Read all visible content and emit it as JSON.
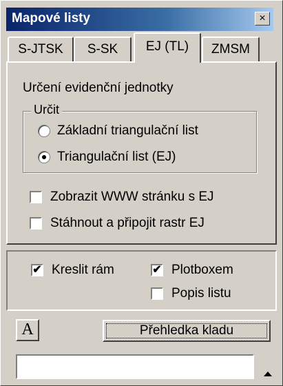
{
  "window": {
    "title": "Mapové listy",
    "close_symbol": "×"
  },
  "tabs": [
    {
      "label": "S-JTSK"
    },
    {
      "label": "S-SK"
    },
    {
      "label": "EJ (TL)",
      "active": true
    },
    {
      "label": "ZMSM"
    }
  ],
  "panel": {
    "heading": "Určení evidenční jednotky",
    "group": {
      "legend": "Určit",
      "options": [
        {
          "label": "Základní triangulační list",
          "selected": false
        },
        {
          "label": "Triangulační list (EJ)",
          "selected": true
        }
      ]
    },
    "checkboxes": [
      {
        "label": "Zobrazit WWW stránku s EJ",
        "checked": false
      },
      {
        "label": "Stáhnout a připojit rastr EJ",
        "checked": false
      }
    ]
  },
  "draw_options": {
    "kreslit_ram": {
      "label": "Kreslit rám",
      "checked": true
    },
    "plotboxem": {
      "label": "Plotboxem",
      "checked": true
    },
    "popis_listu": {
      "label": "Popis listu",
      "checked": false
    }
  },
  "toolbar": {
    "font_button": "A",
    "overview_button": "Přehledka kladu"
  },
  "input": {
    "value": ""
  },
  "icons": {
    "check_mark": "✔"
  }
}
